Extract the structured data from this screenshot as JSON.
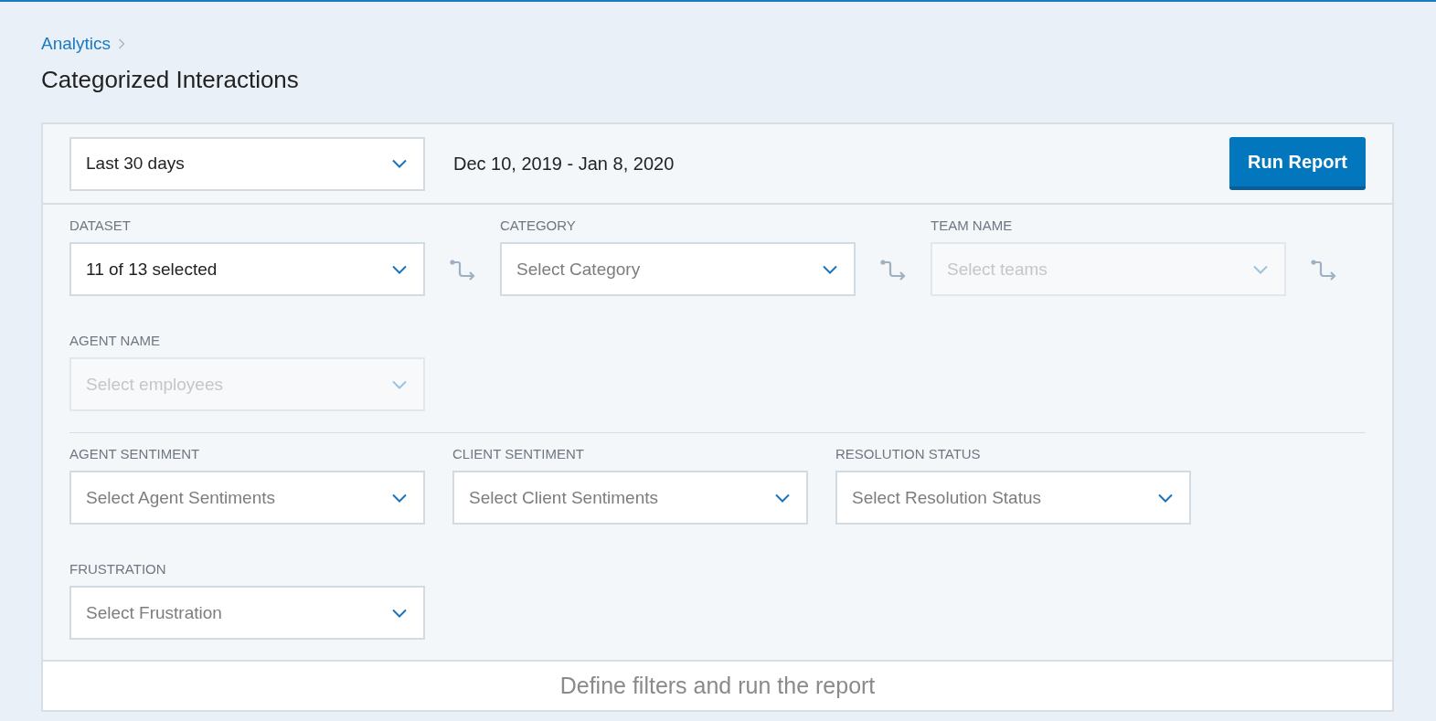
{
  "breadcrumb": [
    {
      "label": "Analytics"
    }
  ],
  "page_title": "Categorized Interactions",
  "date_range": {
    "value": "Last 30 days",
    "dates": "Dec 10, 2019 - Jan 8, 2020"
  },
  "run_button": "Run Report",
  "filter_sections": [
    {
      "filters": [
        {
          "label": "DATASET",
          "value": "11 of 13 selected",
          "disabled": false,
          "linked": true
        },
        {
          "label": "CATEGORY",
          "placeholder": "Select Category",
          "disabled": false,
          "linked": true
        },
        {
          "label": "TEAM NAME",
          "placeholder": "Select teams",
          "disabled": true,
          "linked": true
        },
        {
          "label": "AGENT NAME",
          "placeholder": "Select employees",
          "disabled": true,
          "linked": false
        }
      ]
    },
    {
      "filters": [
        {
          "label": "AGENT SENTIMENT",
          "placeholder": "Select Agent Sentiments",
          "disabled": false
        },
        {
          "label": "CLIENT SENTIMENT",
          "placeholder": "Select Client Sentiments",
          "disabled": false
        },
        {
          "label": "RESOLUTION STATUS",
          "placeholder": "Select Resolution Status",
          "disabled": false
        },
        {
          "label": "FRUSTRATION",
          "placeholder": "Select Frustration",
          "disabled": false
        }
      ]
    }
  ],
  "footer_message": "Define filters and run the report"
}
